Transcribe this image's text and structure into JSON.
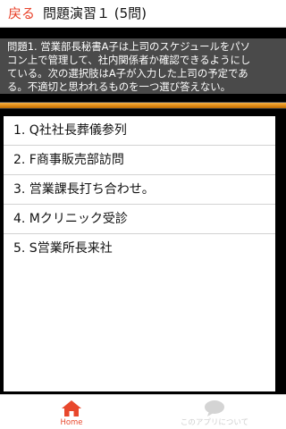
{
  "header": {
    "back_label": "戻る",
    "title": "問題演習１ (5問)"
  },
  "question": {
    "text": "問題1. 営業部長秘書A子は上司のスケジュールをパソ\nコン上で管理して、社内関係者か確認できるようにし\nている。次の選択肢はA子が入力した上司の予定であ\nる。不適切と思われるものを一つ選び答えない。"
  },
  "choices": [
    {
      "label": "1. Q社社長葬儀参列"
    },
    {
      "label": "2. F商事販売部訪問"
    },
    {
      "label": "3. 営業課長打ち合わせ。"
    },
    {
      "label": "4. Mクリニック受診"
    },
    {
      "label": "5. S営業所長来社"
    }
  ],
  "tabbar": {
    "home": {
      "label": "Home",
      "icon": "home-icon"
    },
    "about": {
      "label": "このアプリについて",
      "icon": "speech-bubble-icon"
    }
  },
  "colors": {
    "accent": "#e8472c",
    "question_bg": "#4a4a4a",
    "divider": "#e38d16",
    "inactive_tab": "#cfcfcf"
  }
}
